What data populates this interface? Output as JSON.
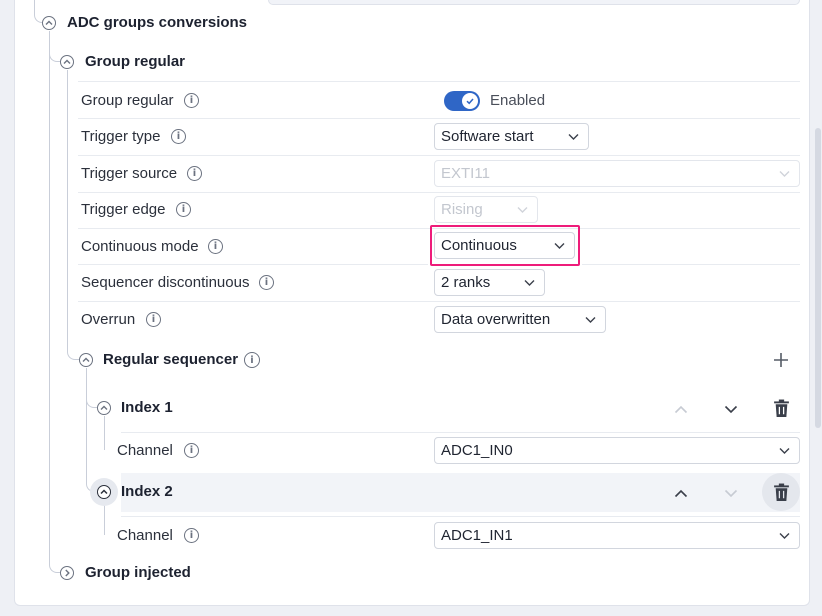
{
  "sections": {
    "adc_groups": {
      "title": "ADC groups conversions"
    },
    "group_regular": {
      "title": "Group regular"
    },
    "regular_sequencer": {
      "title": "Regular sequencer"
    },
    "group_injected": {
      "title": "Group injected"
    }
  },
  "fields": {
    "group_regular": {
      "label": "Group regular",
      "toggle_text": "Enabled",
      "toggle_on": true
    },
    "trigger_type": {
      "label": "Trigger type",
      "value": "Software start"
    },
    "trigger_source": {
      "label": "Trigger source",
      "value": "EXTI11",
      "disabled": true
    },
    "trigger_edge": {
      "label": "Trigger edge",
      "value": "Rising",
      "disabled": true
    },
    "continuous_mode": {
      "label": "Continuous mode",
      "value": "Continuous",
      "highlighted": true
    },
    "sequencer_discontinuous": {
      "label": "Sequencer discontinuous",
      "value": "2 ranks"
    },
    "overrun": {
      "label": "Overrun",
      "value": "Data overwritten"
    }
  },
  "sequencer": {
    "indexes": [
      {
        "title": "Index 1",
        "channel_label": "Channel",
        "channel_value": "ADC1_IN0"
      },
      {
        "title": "Index 2",
        "channel_label": "Channel",
        "channel_value": "ADC1_IN1"
      }
    ]
  },
  "icons": {
    "info": "info-icon",
    "add": "plus-icon",
    "move_up": "chevron-up-icon",
    "move_down": "chevron-down-icon",
    "delete": "trash-icon",
    "collapse": "collapse-circle-icon",
    "expand": "expand-circle-icon"
  },
  "colors": {
    "accent": "#2f66c6",
    "highlight": "#ee1c7a",
    "disabled_text": "#c3c7cf"
  },
  "info_glyph": "i"
}
